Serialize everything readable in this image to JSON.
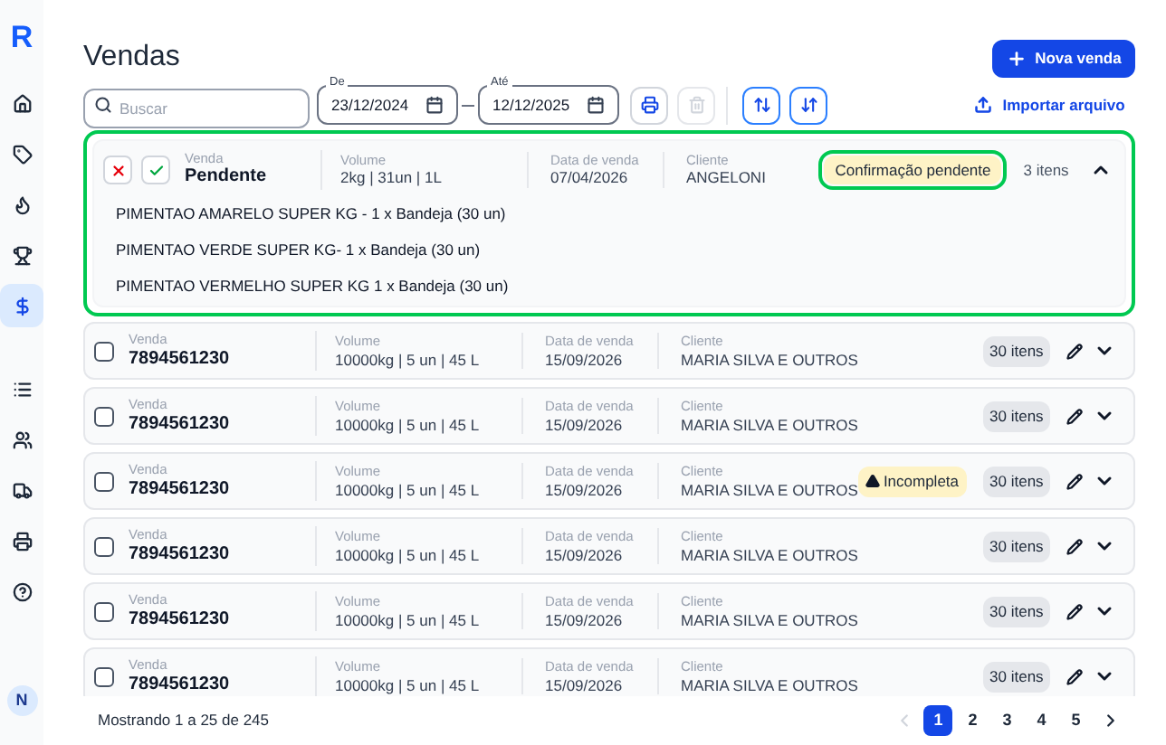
{
  "sidebar": {
    "logo": "R",
    "items": [
      {
        "selected": false
      },
      {
        "selected": false
      },
      {
        "selected": false
      },
      {
        "selected": false
      },
      {
        "selected": true
      },
      {
        "selected": false
      },
      {
        "selected": false
      },
      {
        "selected": false
      },
      {
        "selected": false
      },
      {
        "selected": false
      }
    ],
    "avatar": "N"
  },
  "title": "Vendas",
  "new_button": "Nova venda",
  "filters": {
    "search": {
      "placeholder": "Buscar"
    },
    "from": {
      "label": "De",
      "value": "23/12/2024"
    },
    "to": {
      "label": "Até",
      "value": "12/12/2025"
    }
  },
  "actions": [
    {
      "kind": "print",
      "disabled": false
    },
    {
      "kind": "delete",
      "disabled": true
    }
  ],
  "import_link": "Importar arquivo",
  "expanded_order": {
    "sale_label": "Venda",
    "sale": "Pendente",
    "volume_label": "Volume",
    "volume": "2kg | 31un | 1L",
    "date_label": "Data de venda",
    "date": "07/04/2026",
    "client_label": "Cliente",
    "client": "ANGELONI",
    "status": "Confirmação pendente",
    "count": "3 itens",
    "expanded": true,
    "items": [
      "PIMENTAO AMARELO SUPER KG - 1 x Bandeja (30 un)",
      "PIMENTAO VERDE SUPER KG- 1 x Bandeja (30 un)",
      "PIMENTAO VERMELHO SUPER KG 1 x Bandeja (30 un)"
    ]
  },
  "orders": [
    {
      "checked": false,
      "sale_label": "Venda",
      "sale": "7894561230",
      "volume_label": "Volume",
      "volume": "10000kg | 5 un | 45 L",
      "date_label": "Data de venda",
      "date": "15/09/2026",
      "client_label": "Cliente",
      "client": "MARIA SILVA E OUTROS",
      "count": "30 itens",
      "expanded": false
    },
    {
      "checked": false,
      "sale_label": "Venda",
      "sale": "7894561230",
      "volume_label": "Volume",
      "volume": "10000kg | 5 un | 45 L",
      "date_label": "Data de venda",
      "date": "15/09/2026",
      "client_label": "Cliente",
      "client": "MARIA SILVA E OUTROS",
      "count": "30 itens",
      "expanded": false
    },
    {
      "checked": false,
      "sale_label": "Venda",
      "sale": "7894561230",
      "volume_label": "Volume",
      "volume": "10000kg | 5 un | 45 L",
      "date_label": "Data de venda",
      "date": "15/09/2026",
      "client_label": "Cliente",
      "client": "MARIA SILVA E OUTROS",
      "warning": "Incompleta",
      "count": "30 itens",
      "expanded": false
    },
    {
      "checked": false,
      "sale_label": "Venda",
      "sale": "7894561230",
      "volume_label": "Volume",
      "volume": "10000kg | 5 un | 45 L",
      "date_label": "Data de venda",
      "date": "15/09/2026",
      "client_label": "Cliente",
      "client": "MARIA SILVA E OUTROS",
      "count": "30 itens",
      "expanded": false
    },
    {
      "checked": false,
      "sale_label": "Venda",
      "sale": "7894561230",
      "volume_label": "Volume",
      "volume": "10000kg | 5 un | 45 L",
      "date_label": "Data de venda",
      "date": "15/09/2026",
      "client_label": "Cliente",
      "client": "MARIA SILVA E OUTROS",
      "count": "30 itens",
      "expanded": false
    },
    {
      "checked": false,
      "sale_label": "Venda",
      "sale": "7894561230",
      "volume_label": "Volume",
      "volume": "10000kg | 5 un | 45 L",
      "date_label": "Data de venda",
      "date": "15/09/2026",
      "client_label": "Cliente",
      "client": "MARIA SILVA E OUTROS",
      "count": "30 itens",
      "expanded": false
    }
  ],
  "pagination": {
    "summary": "Mostrando 1 a 25 de 245",
    "previous": {
      "disabled": true
    },
    "next": {
      "disabled": false
    },
    "pages": [
      {
        "label": "1",
        "selected": true
      },
      {
        "label": "2",
        "selected": false
      },
      {
        "label": "3",
        "selected": false
      },
      {
        "label": "4",
        "selected": false
      },
      {
        "label": "5",
        "selected": false
      }
    ]
  }
}
